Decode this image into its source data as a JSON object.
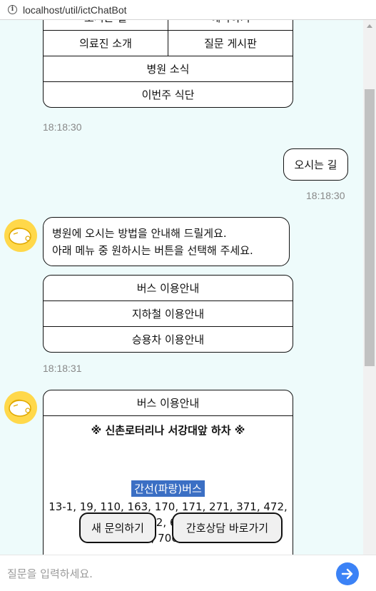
{
  "browser": {
    "url": "localhost/util/ictChatBot"
  },
  "menu1": {
    "rows": [
      [
        "오시는 길",
        "예약하기"
      ],
      [
        "의료진 소개",
        "질문 게시판"
      ],
      [
        "병원 소식"
      ],
      [
        "이번주 식단"
      ]
    ]
  },
  "time1": "18:18:30",
  "user_msg": {
    "text": "오시는 길",
    "time": "18:18:30"
  },
  "bot_msg": {
    "line1": "병원에 오시는 방법을 안내해 드릴게요.",
    "line2": "아래 메뉴 중 원하시는 버튼을 선택해 주세요."
  },
  "menu2": {
    "items": [
      "버스 이용안내",
      "지하철 이용안내",
      "승용차 이용안내"
    ]
  },
  "time2": "18:18:31",
  "bus_card": {
    "title": "버스 이용안내",
    "subtitle": "※ 신촌로터리나 서강대앞 하차 ※",
    "label": "간선(파랑)버스",
    "line1": "13-1, 19, 110, 163, 170, 171, 271, 371, 472,",
    "line2": "602, 603,",
    "line3": "705, 706, 752"
  },
  "actions": {
    "new_query": "새 문의하기",
    "nurse": "간호상담 바로가기"
  },
  "input": {
    "placeholder": "질문을 입력하세요."
  },
  "colors": {
    "chat_bg": "#eefbfb",
    "accent": "#3b82f6",
    "bus_label": "#3b6fc4",
    "avatar": "#ffd84a"
  }
}
